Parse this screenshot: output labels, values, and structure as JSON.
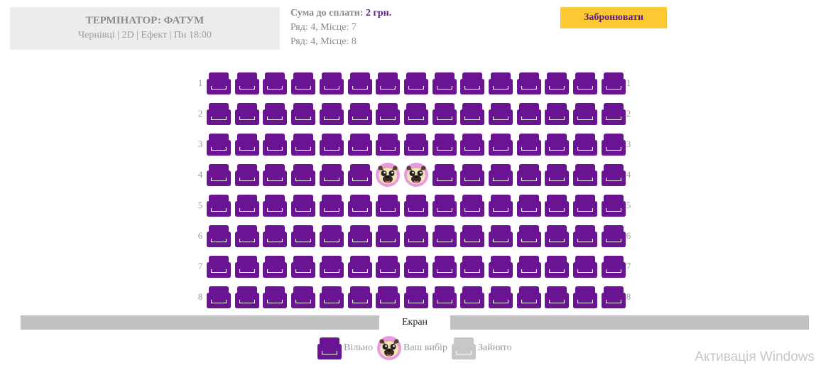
{
  "movie": {
    "title": "ТЕРМІНАТОР: ФАТУМ",
    "info": "Чернівці | 2D | Ефект | Пн 18:00"
  },
  "summary": {
    "total_label": "Сума до сплати:",
    "total_value": "2 грн.",
    "selected": [
      "Ряд: 4, Місце: 7",
      "Ряд: 4, Місце: 8"
    ]
  },
  "book_button": "Забронювати",
  "hall": {
    "rows": 8,
    "seats_per_row": 15,
    "row_labels": [
      "1",
      "2",
      "3",
      "4",
      "5",
      "6",
      "7",
      "8"
    ],
    "selected_seats": [
      {
        "row": 4,
        "seat": 7
      },
      {
        "row": 4,
        "seat": 8
      }
    ],
    "occupied_seats": []
  },
  "screen_label": "Екран",
  "legend": {
    "free": "Вільно",
    "selected": "Ваш вибір",
    "occupied": "Зайнято"
  },
  "colors": {
    "free": "#6a1494",
    "occupied": "#c7c7c7",
    "accent": "#fcc933",
    "selected_bg": "#e89ae0"
  },
  "icons": {
    "free": "seat-free-icon",
    "selected": "seat-selected-pug-icon",
    "occupied": "seat-occupied-icon"
  },
  "watermark": "Активація Windows"
}
